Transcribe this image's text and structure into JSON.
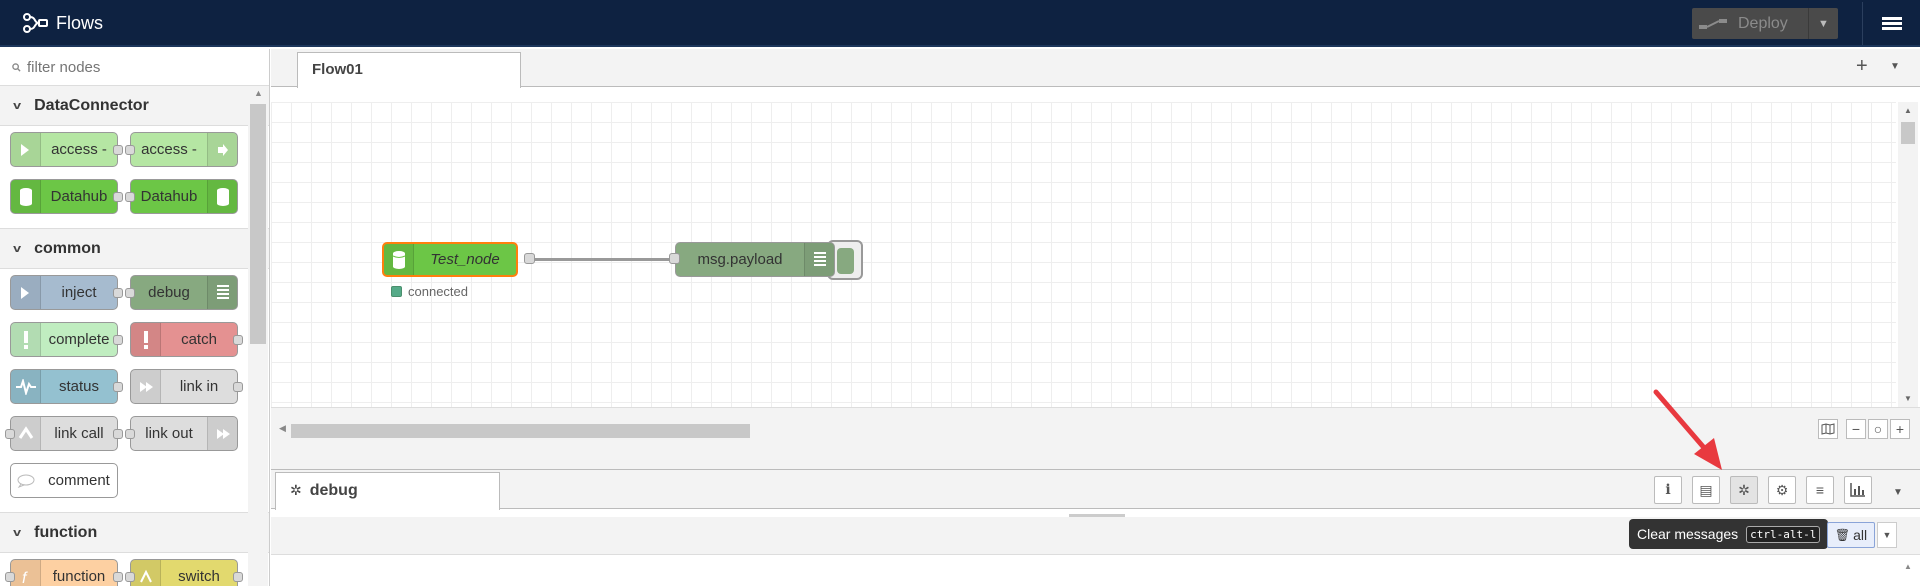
{
  "header": {
    "title": "Flows",
    "deploy_label": "Deploy"
  },
  "palette": {
    "search_placeholder": "filter nodes",
    "categories": [
      {
        "name": "DataConnector",
        "rows": [
          [
            {
              "label": "access -",
              "color": "#b5e6a3",
              "icon": "arrow-in-icon"
            },
            {
              "label": "access -",
              "color": "#b5e6a3",
              "icon": "arrow-out-icon"
            }
          ],
          [
            {
              "label": "Datahub",
              "color": "#6cc646",
              "icon": "database-icon"
            },
            {
              "label": "Datahub",
              "color": "#6cc646",
              "icon": "database-icon"
            }
          ]
        ]
      },
      {
        "name": "common",
        "rows": [
          [
            {
              "label": "inject",
              "color": "#a6bbcf",
              "icon": "arrow-in-icon"
            },
            {
              "label": "debug",
              "color": "#87a980",
              "icon": "list-icon"
            }
          ],
          [
            {
              "label": "complete",
              "color": "#c0edc0",
              "icon": "exclamation-icon"
            },
            {
              "label": "catch",
              "color": "#e49191",
              "icon": "exclamation-icon"
            }
          ],
          [
            {
              "label": "status",
              "color": "#94c1d0",
              "icon": "pulse-icon"
            },
            {
              "label": "link in",
              "color": "#dddddd",
              "icon": "link-in-icon"
            }
          ],
          [
            {
              "label": "link call",
              "color": "#dddddd",
              "icon": "link-call-icon"
            },
            {
              "label": "link out",
              "color": "#dddddd",
              "icon": "link-out-icon"
            }
          ],
          [
            {
              "label": "comment",
              "color": "#ffffff",
              "icon": "comment-icon"
            }
          ]
        ]
      },
      {
        "name": "function",
        "rows": [
          [
            {
              "label": "function",
              "color": "#fdd0a2",
              "icon": "function-icon"
            },
            {
              "label": "switch",
              "color": "#e2d96e",
              "icon": "switch-icon"
            }
          ]
        ]
      }
    ]
  },
  "workspace": {
    "tab_label": "Flow01",
    "nodes": {
      "test_node_label": "Test_node",
      "test_node_status": "connected",
      "debug_node_label": "msg.payload"
    }
  },
  "sidebar": {
    "tab_label": "debug",
    "tooltip_text": "Clear messages",
    "tooltip_shortcut": "ctrl-alt-l",
    "clear_label": "all"
  },
  "colors": {
    "header_bg": "#0e2241",
    "annotation": "#e8393f"
  }
}
